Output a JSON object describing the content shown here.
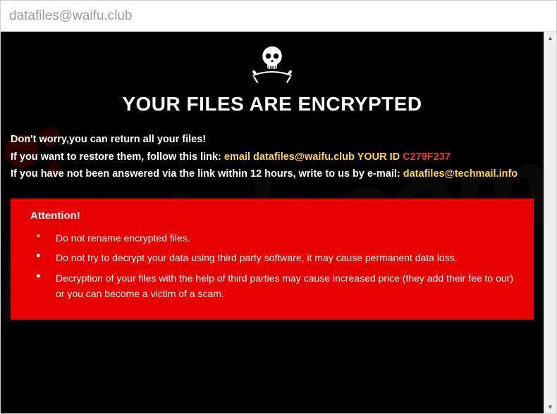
{
  "window": {
    "title": "datafiles@waifu.club"
  },
  "heading": "YOUR FILES ARE ENCRYPTED",
  "intro": {
    "line1": "Don't worry,you can return all your files!",
    "line2_prefix": "If you want to restore them, follow this link: ",
    "line2_email_label": "email datafiles@waifu.club",
    "line2_yourid_label": "  YOUR ID ",
    "line2_id_value": "C279F237",
    "line3_prefix": "If you have not been answered via the link within 12 hours, write to us by e-mail: ",
    "line3_email": "datafiles@techmail.info"
  },
  "attention": {
    "title": "Attention!",
    "bullets": [
      "Do not rename encrypted files.",
      "Do not try to decrypt your data using third party software, it may cause permanent data loss.",
      "Decryption of your files with the help of third parties may cause increased price (they add their fee to our) or you can become a victim of a scam."
    ]
  },
  "icons": {
    "skull": "skull-crossbones-icon",
    "scroll_up": "scroll-up-icon",
    "scroll_down": "scroll-down-icon"
  }
}
